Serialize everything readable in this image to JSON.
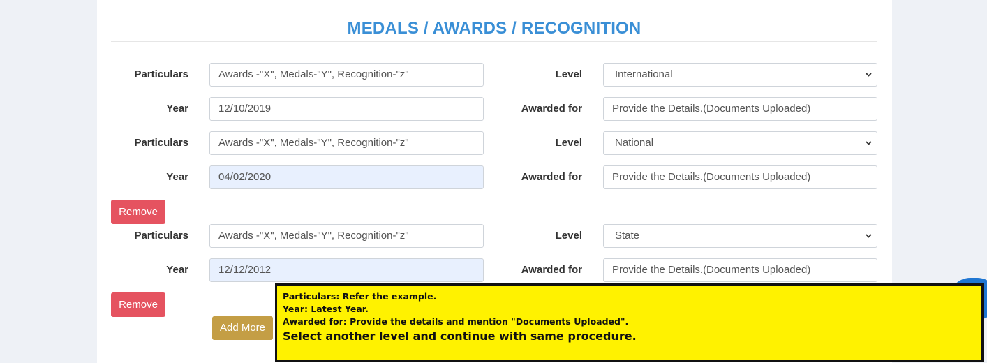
{
  "section": {
    "title": "MEDALS / AWARDS / RECOGNITION"
  },
  "labels": {
    "particulars": "Particulars",
    "year": "Year",
    "level": "Level",
    "awarded_for": "Awarded for"
  },
  "entries": [
    {
      "particulars_placeholder": "Awards -\"X\", Medals-\"Y\", Recognition-\"z\"",
      "year": "12/10/2019",
      "level": "International",
      "awarded_for_placeholder": "Provide the Details.(Documents Uploaded)"
    },
    {
      "particulars_placeholder": "Awards -\"X\", Medals-\"Y\", Recognition-\"z\"",
      "year": "04/02/2020",
      "level": "National",
      "awarded_for_placeholder": "Provide the Details.(Documents Uploaded)"
    },
    {
      "particulars_placeholder": "Awards -\"X\", Medals-\"Y\", Recognition-\"z\"",
      "year": "12/12/2012",
      "level": "State",
      "awarded_for_placeholder": "Provide the Details.(Documents Uploaded)"
    }
  ],
  "buttons": {
    "remove": "Remove",
    "add_more": "Add More"
  },
  "note": {
    "line1": "Particulars: Refer the example.",
    "line2": "Year: Latest Year.",
    "line3": "Awarded for: Provide the details and mention \"Documents Uploaded\".",
    "line4": "Select another level and continue with same procedure."
  },
  "colors": {
    "title": "#3a8fd6",
    "remove_button": "#e55360",
    "add_button": "#c49e45",
    "note_background": "#fff200",
    "autofill_background": "#e8f0fe"
  }
}
